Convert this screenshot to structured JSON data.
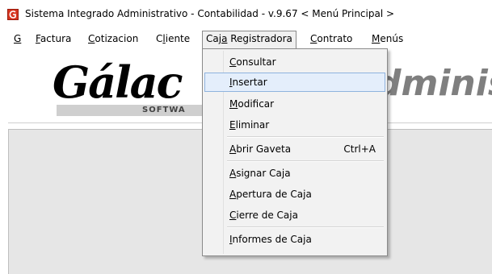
{
  "window": {
    "title": "Sistema Integrado Administrativo - Contabilidad - v.9.67 < Menú Principal >"
  },
  "menubar": {
    "items": [
      {
        "before": "",
        "key": "G",
        "after": ""
      },
      {
        "before": "",
        "key": "F",
        "after": "actura"
      },
      {
        "before": "",
        "key": "C",
        "after": "otizacion"
      },
      {
        "before": "C",
        "key": "l",
        "after": "iente"
      },
      {
        "before": "Caj",
        "key": "a",
        "after": " Registradora"
      },
      {
        "before": "",
        "key": "C",
        "after": "ontrato"
      },
      {
        "before": "",
        "key": "M",
        "after": "enús"
      }
    ]
  },
  "logo": {
    "main": "Gálac",
    "sub": "SOFTWA",
    "right": "dminis"
  },
  "dropdown": {
    "items": [
      {
        "before": "",
        "key": "C",
        "after": "onsultar",
        "shortcut": ""
      },
      {
        "before": "",
        "key": "I",
        "after": "nsertar",
        "shortcut": ""
      },
      {
        "before": "",
        "key": "M",
        "after": "odificar",
        "shortcut": ""
      },
      {
        "before": "",
        "key": "E",
        "after": "liminar",
        "shortcut": ""
      },
      {
        "before": "",
        "key": "A",
        "after": "brir Gaveta",
        "shortcut": "Ctrl+A"
      },
      {
        "before": "",
        "key": "A",
        "after": "signar Caja",
        "shortcut": ""
      },
      {
        "before": "",
        "key": "A",
        "after": "pertura de Caja",
        "shortcut": ""
      },
      {
        "before": "",
        "key": "C",
        "after": "ierre de Caja",
        "shortcut": ""
      },
      {
        "before": "",
        "key": "I",
        "after": "nformes de Caja",
        "shortcut": ""
      }
    ],
    "highlighted_index": 1
  }
}
